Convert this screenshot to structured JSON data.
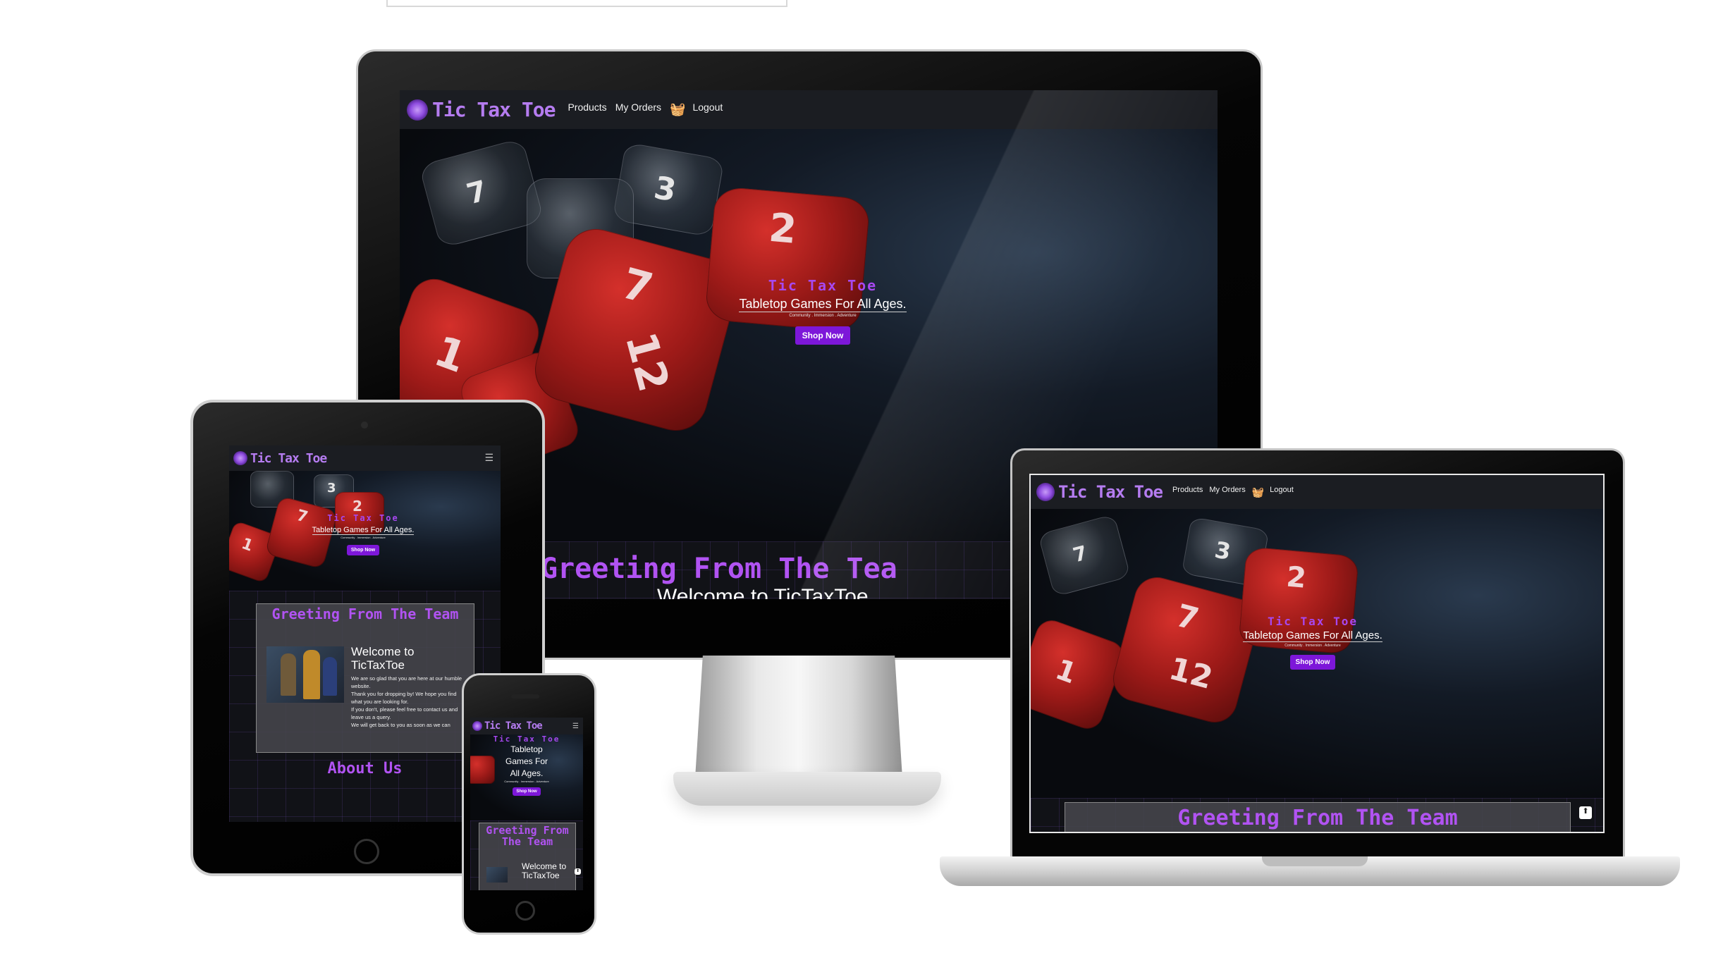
{
  "site": {
    "logo_text": "Tic Tax Toe",
    "nav_links": {
      "products": "Products",
      "orders": "My Orders",
      "logout": "Logout"
    },
    "hero": {
      "title": "Tic Tax Toe",
      "subtitle": "Tabletop Games For All Ages.",
      "tagline": "Community . Immersion . Adventure",
      "cta": "Shop Now"
    },
    "greeting": "Greeting From The Team",
    "greeting_desktop": "Greeting From The Tea",
    "welcome": "Welcome to TicTaxToe",
    "welcome_partial": "Welcome to TicTaxToe",
    "paragraphs": [
      "We are so glad that you are here at our humble website.",
      "Thank you for dropping by! We hope you find what you are looking for.",
      "If you don't, please feel free to contact us and leave us a query.",
      "We will get back to you as soon as we can"
    ],
    "about": "About Us",
    "tablet_sub_lines": [
      "Tabletop",
      "Games For",
      "All Ages."
    ]
  },
  "colors": {
    "accent": "#7d17d9",
    "title_purple": "#a748f0",
    "nav_bg": "#1b1d22"
  },
  "icons": {
    "basket": "basket-icon",
    "menu": "hamburger-menu-icon",
    "up": "arrow-up-icon"
  }
}
